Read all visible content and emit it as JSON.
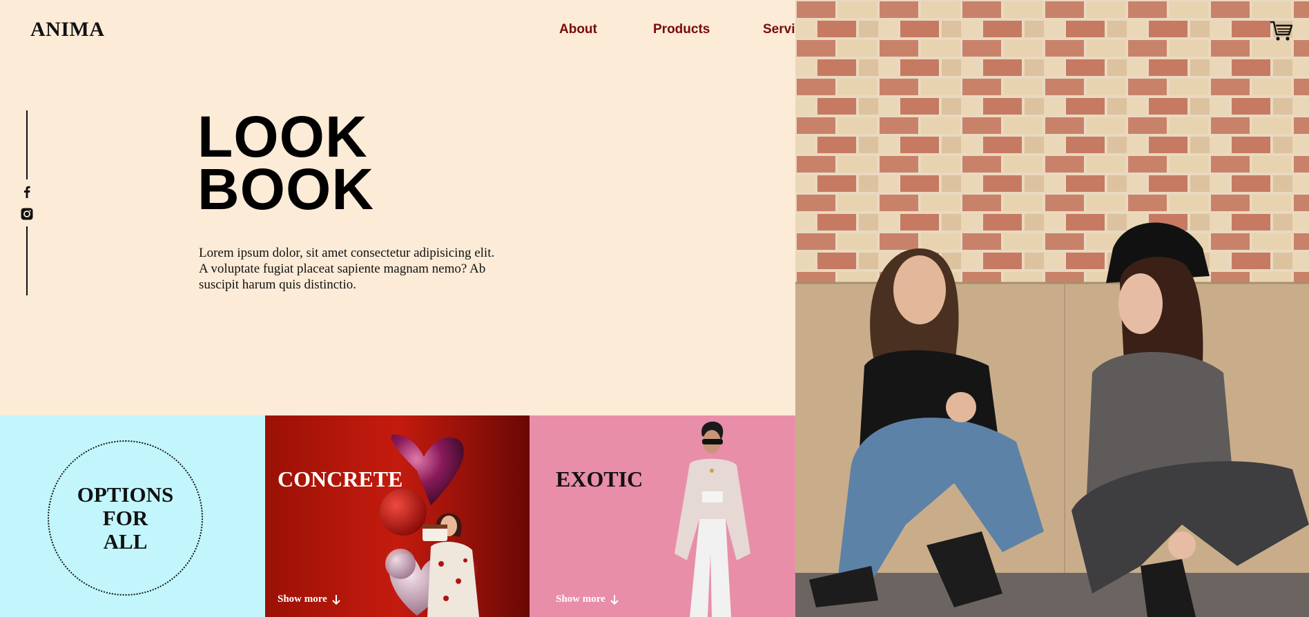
{
  "brand": {
    "logo": "ANIMA"
  },
  "nav": {
    "items": [
      {
        "label": "About"
      },
      {
        "label": "Products"
      },
      {
        "label": "Services"
      }
    ]
  },
  "social": {
    "icons": [
      "facebook-icon",
      "instagram-icon"
    ]
  },
  "hero": {
    "title_line1": "LOOK",
    "title_line2": "BOOK",
    "description": "Lorem ipsum dolor, sit amet consectetur adipisicing elit. A voluptate fugiat placeat sapiente magnam nemo? Ab suscipit harum quis distinctio."
  },
  "cards": {
    "options": {
      "line1": "OPTIONS",
      "line2": "FOR",
      "line3": "ALL"
    },
    "concrete": {
      "title": "CONCRETE",
      "cta": "Show more"
    },
    "exotic": {
      "title": "EXOTIC",
      "cta": "Show more"
    }
  },
  "header": {
    "cart_icon": "cart-icon"
  },
  "colors": {
    "background": "#fbebd7",
    "nav_link": "#7a0a07",
    "options_card": "#c2f6fc",
    "concrete_card": "#9b1105",
    "exotic_card": "#e88ea9"
  }
}
